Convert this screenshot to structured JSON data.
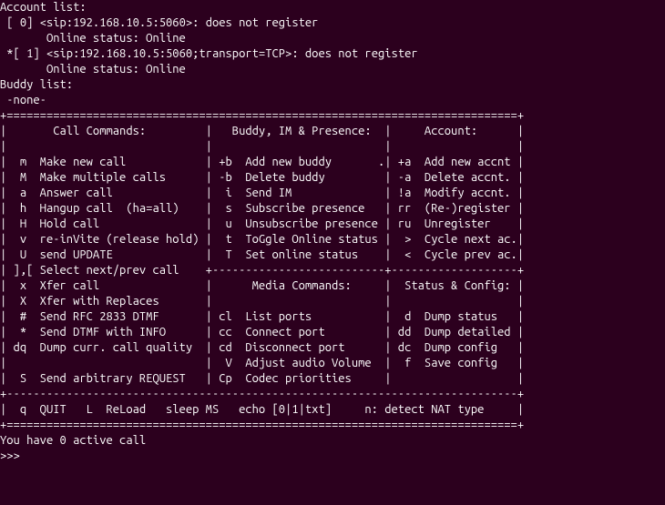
{
  "header": {
    "account_list_label": "Account list:",
    "accounts": [
      {
        "prefix": " [ 0] ",
        "uri": "<sip:192.168.10.5:5060>",
        "reg": ": does not register",
        "status_line": "       Online status: Online"
      },
      {
        "prefix": " *[ 1] ",
        "uri": "<sip:192.168.10.5:5060;transport=TCP>",
        "reg": ": does not register",
        "status_line": "       Online status: Online"
      }
    ],
    "buddy_list_label": "Buddy list:",
    "buddy_none": " -none-",
    "blank": ""
  },
  "menu": {
    "top_rule": "+=============================================================================+",
    "hdr_call": "|       Call Commands:         |   Buddy, IM & Presence:  |     Account:      |",
    "hdr_blank": "|                              |                          |                   |",
    "row1": "|  m  Make new call            | +b  Add new buddy       .| +a  Add new accnt |",
    "row2": "|  M  Make multiple calls      | -b  Delete buddy         | -a  Delete accnt. |",
    "row3": "|  a  Answer call              |  i  Send IM              | !a  Modify accnt. |",
    "row4": "|  h  Hangup call  (ha=all)    |  s  Subscribe presence   | rr  (Re-)register |",
    "row5": "|  H  Hold call                |  u  Unsubscribe presence | ru  Unregister    |",
    "row6": "|  v  re-inVite (release hold) |  t  ToGgle Online status |  >  Cycle next ac.|",
    "row7": "|  U  send UPDATE              |  T  Set online status    |  <  Cycle prev ac.|",
    "row8": "| ],[ Select next/prev call    +--------------------------+-------------------+",
    "row9": "|  x  Xfer call                |      Media Commands:     |  Status & Config: |",
    "row10": "|  X  Xfer with Replaces       |                          |                   |",
    "row11": "|  #  Send RFC 2833 DTMF       | cl  List ports           |  d  Dump status   |",
    "row12": "|  *  Send DTMF with INFO      | cc  Connect port         | dd  Dump detailed |",
    "row13": "| dq  Dump curr. call quality  | cd  Disconnect port      | dc  Dump config   |",
    "row14": "|                              |  V  Adjust audio Volume  |  f  Save config   |",
    "row15": "|  S  Send arbitrary REQUEST   | Cp  Codec priorities     |                   |",
    "mid_rule": "+-----------------------------------------------------------------------------+",
    "footer_row": "|  q  QUIT   L  ReLoad   sleep MS   echo [0|1|txt]     n: detect NAT type     |",
    "bot_rule": "+=============================================================================+"
  },
  "footer": {
    "active_call": "You have 0 active call",
    "prompt": ">>>"
  }
}
